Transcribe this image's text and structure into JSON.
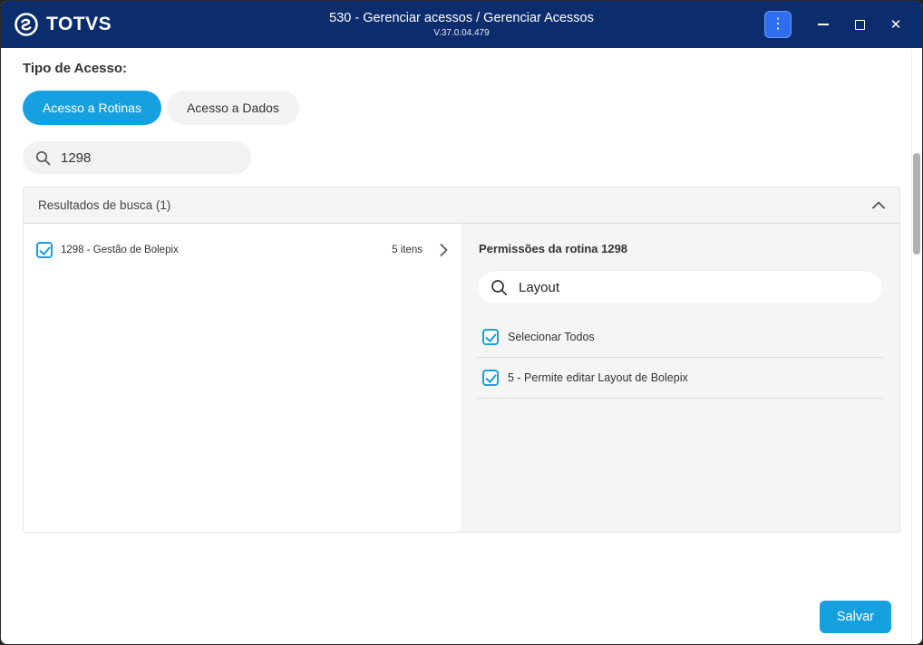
{
  "titlebar": {
    "brand": "TOTVS",
    "title": "530 - Gerenciar acessos / Gerenciar Acessos",
    "version": "V.37.0.04.479",
    "kebab": "⋮",
    "close": "✕"
  },
  "access_type": {
    "label": "Tipo de Acesso:",
    "tabs": [
      {
        "label": "Acesso a Rotinas",
        "active": true
      },
      {
        "label": "Acesso a Dados",
        "active": false
      }
    ]
  },
  "search": {
    "value": "1298"
  },
  "results": {
    "header": "Resultados de busca (1)",
    "items": [
      {
        "label": "1298 - Gestão de Bolepix",
        "count": "5 itens",
        "checked": true
      }
    ]
  },
  "permissions": {
    "title": "Permissões da rotina 1298",
    "search_value": "Layout",
    "select_all": "Selecionar Todos",
    "items": [
      {
        "label": "5 - Permite editar Layout de Bolepix",
        "checked": true
      }
    ]
  },
  "footer": {
    "save_label": "Salvar"
  },
  "colors": {
    "accent": "#17a0e0",
    "titlebar": "#0c2d6d",
    "kebab_button": "#2e6ff0"
  }
}
